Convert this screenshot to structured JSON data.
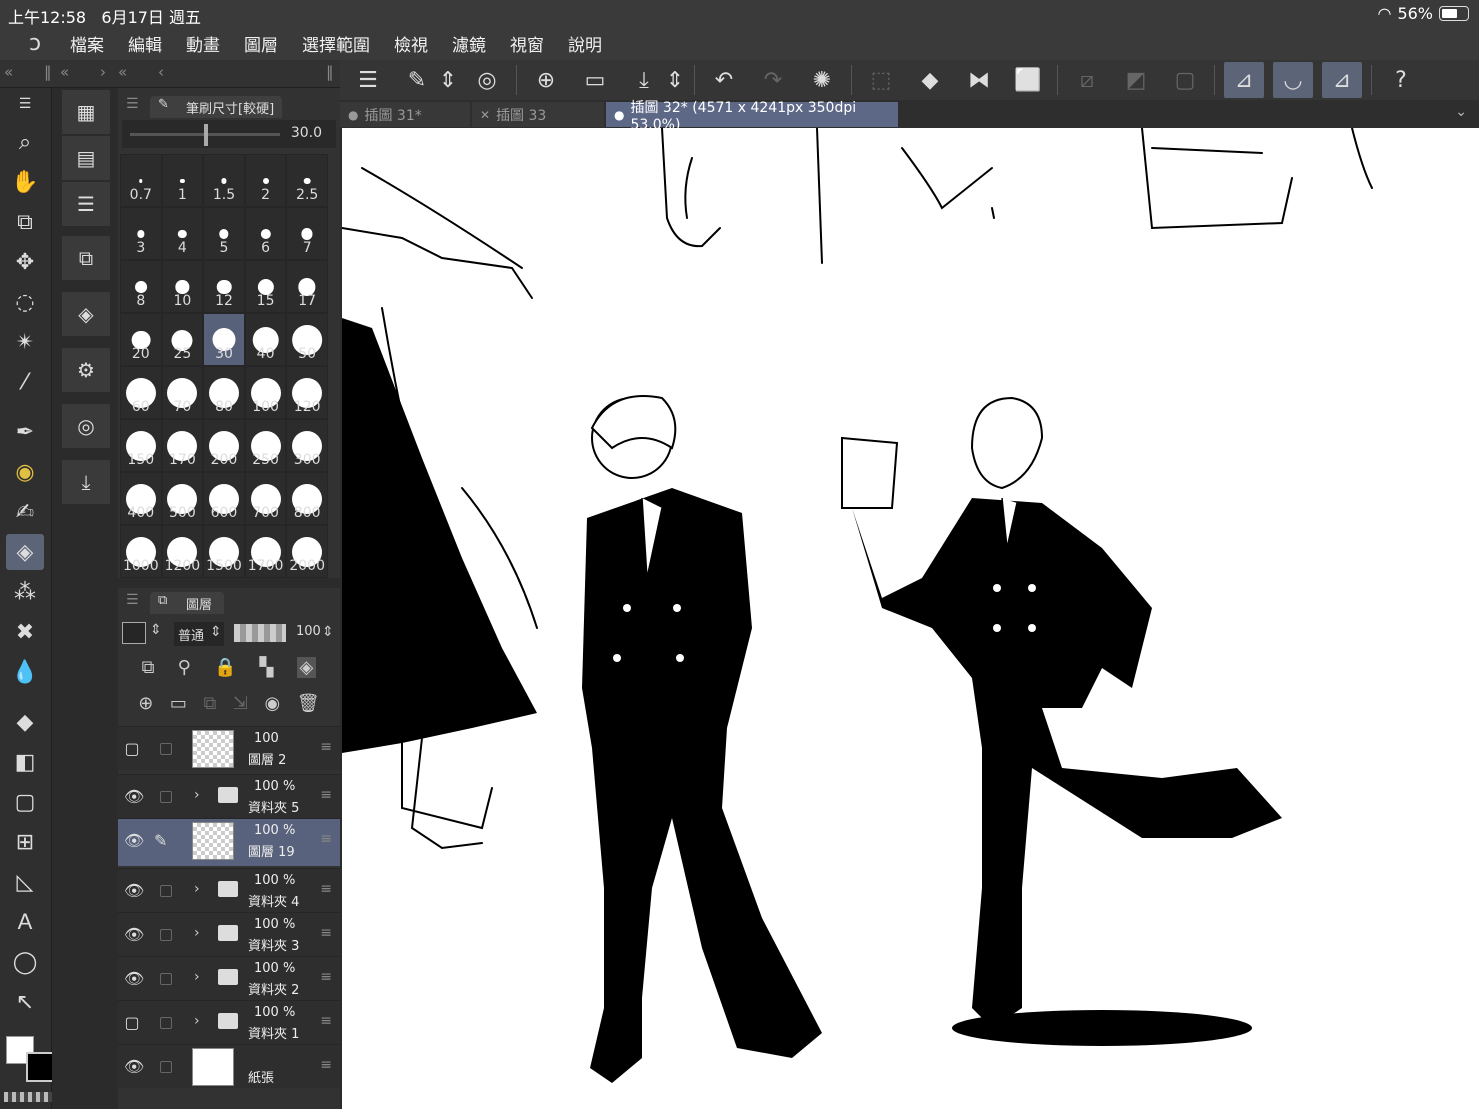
{
  "status": {
    "time": "上午12:58",
    "date": "6月17日 週五",
    "battery": "56%",
    "battery_level": 0.56
  },
  "menu": [
    "檔案",
    "編輯",
    "動畫",
    "圖層",
    "選擇範圍",
    "檢視",
    "濾鏡",
    "視窗",
    "說明"
  ],
  "tabs": [
    {
      "label": "插圖 31*"
    },
    {
      "label": "插圖 33"
    },
    {
      "label": "插圖 32* (4571 x 4241px 350dpi 53.0%)"
    }
  ],
  "brush_panel": {
    "title": "筆刷尺寸[較硬]",
    "value": "30.0",
    "sizes": [
      "0.7",
      "1",
      "1.5",
      "2",
      "2.5",
      "3",
      "4",
      "5",
      "6",
      "7",
      "8",
      "10",
      "12",
      "15",
      "17",
      "20",
      "25",
      "30",
      "40",
      "50",
      "60",
      "70",
      "80",
      "100",
      "120",
      "150",
      "170",
      "200",
      "250",
      "300",
      "400",
      "500",
      "600",
      "700",
      "800",
      "1000",
      "1200",
      "1500",
      "1700",
      "2000"
    ],
    "selected": "30"
  },
  "layer_panel": {
    "title": "圖層",
    "blend_mode": "普通",
    "opacity": "100",
    "layers": [
      {
        "pct": "100",
        "name": "圖層 2",
        "visible": false,
        "type": "raster"
      },
      {
        "pct": "100 %",
        "name": "資料夾 5",
        "visible": true,
        "type": "folder"
      },
      {
        "pct": "100 %",
        "name": "圖層 19",
        "visible": true,
        "type": "raster",
        "selected": true
      },
      {
        "pct": "100 %",
        "name": "資料夾 4",
        "visible": true,
        "type": "folder"
      },
      {
        "pct": "100 %",
        "name": "資料夾 3",
        "visible": true,
        "type": "folder"
      },
      {
        "pct": "100 %",
        "name": "資料夾 2",
        "visible": true,
        "type": "folder"
      },
      {
        "pct": "100 %",
        "name": "資料夾 1",
        "visible": false,
        "type": "folder"
      },
      {
        "pct": "",
        "name": "紙張",
        "visible": true,
        "type": "paper"
      }
    ]
  },
  "icons": {
    "tools": [
      "zoom-icon",
      "hand-icon",
      "layer-move-icon",
      "move-icon",
      "lasso-icon",
      "magic-wand-icon",
      "eyedropper-icon",
      "pen-icon",
      "decoration-icon",
      "brush-icon",
      "eraser-icon",
      "airbrush-icon",
      "blend-icon",
      "water-icon",
      "fill-icon",
      "gradient-icon",
      "rectangle-icon",
      "frame-icon",
      "ruler-icon",
      "text-icon",
      "balloon-icon",
      "correct-line-icon"
    ],
    "accent": "#5c6478"
  }
}
